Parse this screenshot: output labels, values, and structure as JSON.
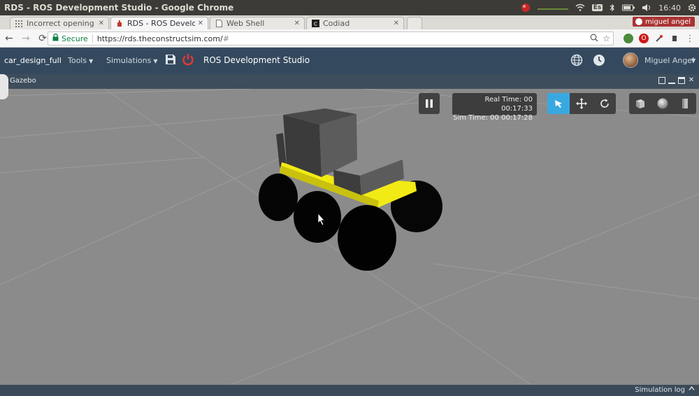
{
  "os": {
    "window_title": "RDS - ROS Development Studio - Google Chrome",
    "lang": "Es",
    "clock": "16:40"
  },
  "browser": {
    "tabs": [
      {
        "label": "Incorrect opening",
        "active": false
      },
      {
        "label": "RDS - ROS Develop",
        "active": true
      },
      {
        "label": "Web Shell",
        "active": false
      },
      {
        "label": "Codiad",
        "active": false
      }
    ],
    "profile": "miguel angel",
    "secure_label": "Secure",
    "url_scheme_host": "https://rds.theconstructsim.com/",
    "url_rest": "#"
  },
  "app": {
    "project": "car_design_full",
    "menu_tools": "Tools",
    "menu_simulations": "Simulations",
    "title": "ROS Development Studio",
    "user": "Miguel Angel"
  },
  "gazebo": {
    "panel_title": "Gazebo",
    "real_time_label": "Real Time:",
    "real_time": "00 00:17:33",
    "sim_time_label": "Sim Time:",
    "sim_time": "00 00:17:28",
    "active_tool": "select"
  },
  "footer": {
    "sim_log": "Simulation log"
  },
  "colors": {
    "navbar": "#34495e",
    "accent_tool": "#3aa8e0",
    "chassis": "#f2ea14"
  }
}
